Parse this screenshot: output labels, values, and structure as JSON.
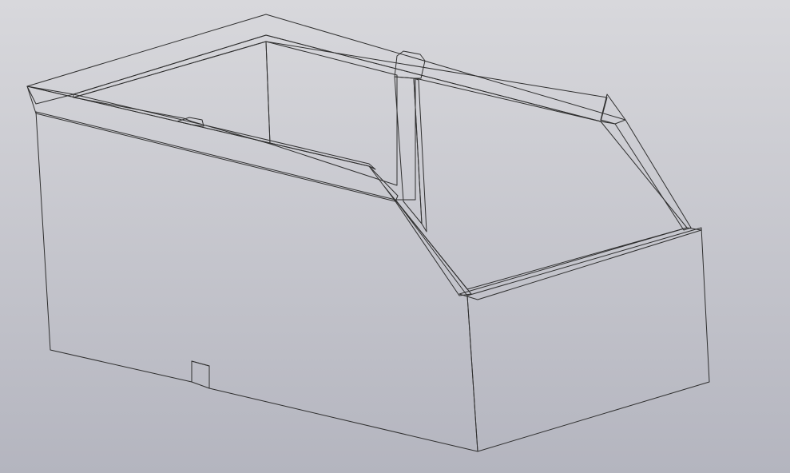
{
  "viewport": {
    "background_top": "#d8d8dc",
    "background_bottom": "#b4b5bf"
  },
  "model": {
    "name": "",
    "colors": {
      "outer_wall": "#646464",
      "inner_wall_dark": "#5f5f5f",
      "inner_wall_light": "#8e8e8e",
      "rim_top": "#8a8a8a",
      "rim_highlight": "#a6a6a6",
      "front_face": "#7c7c7c",
      "edge": "#2f2f2f"
    }
  }
}
